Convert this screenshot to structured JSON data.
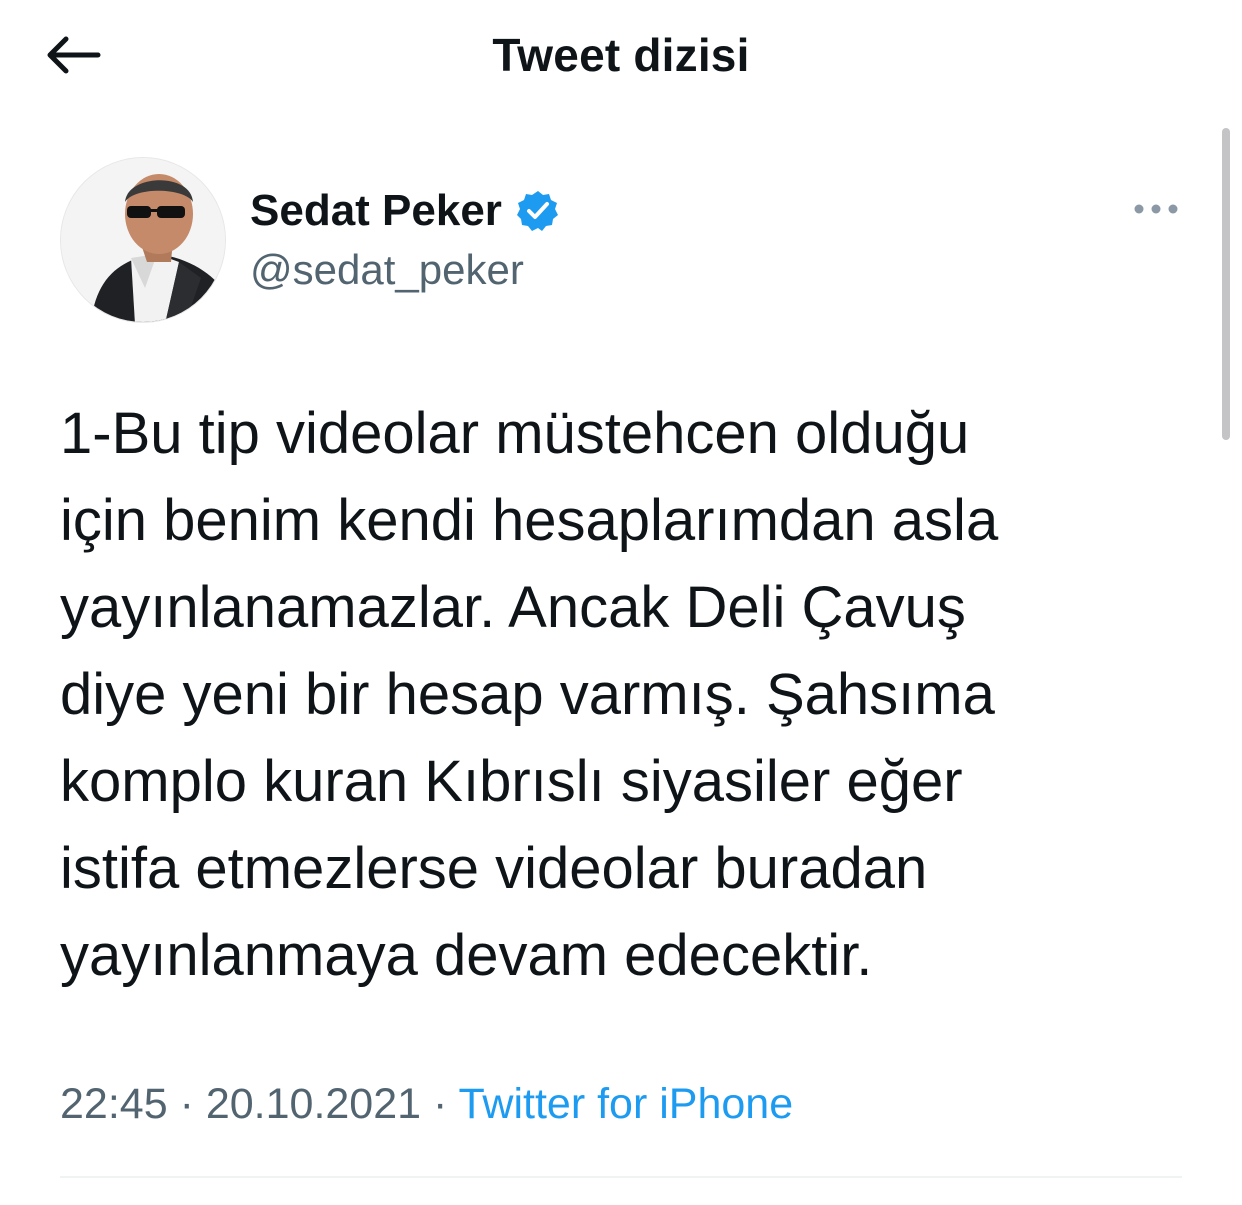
{
  "header": {
    "title": "Tweet dizisi",
    "back_icon": "arrow-left-icon"
  },
  "tweet": {
    "author": {
      "name": "Sedat Peker",
      "handle": "@sedat_peker",
      "verified": true,
      "verified_icon": "verified-badge-icon",
      "verified_color": "#1d9bf0"
    },
    "more_icon": "ellipsis-icon",
    "text": "1-Bu tip videolar müstehcen olduğu\niçin benim kendi hesaplarımdan asla\nyayınlanamazlar. Ancak Deli Çavuş\ndiye yeni bir hesap varmış. Şahsıma\nkomplo kuran Kıbrıslı siyasiler eğer\nistifa etmezlerse videolar buradan\nyayınlanmaya devam edecektir.",
    "time": "22:45",
    "separator": "·",
    "date": "20.10.2021",
    "source": "Twitter for iPhone"
  },
  "colors": {
    "text": "#0f1419",
    "secondary": "#536471",
    "accent": "#1d9bf0",
    "divider": "#eff3f4"
  }
}
